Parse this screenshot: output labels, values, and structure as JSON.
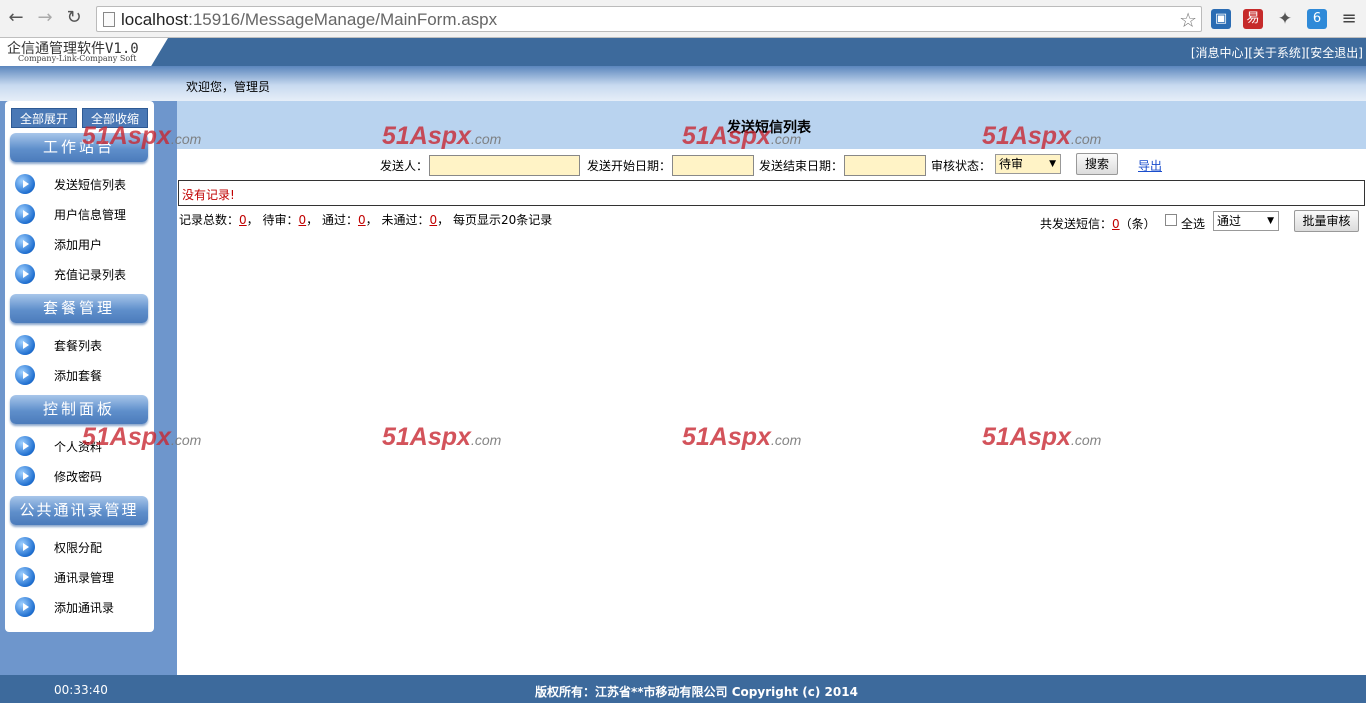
{
  "browser": {
    "url_host": "localhost",
    "url_rest": ":15916/MessageManage/MainForm.aspx"
  },
  "header": {
    "app_name": "企信通管理软件V1.0",
    "app_sub": "Company-Link-Company Soft",
    "links": [
      "[消息中心]",
      "[关于系统]",
      "[安全退出]"
    ]
  },
  "welcome": "欢迎您，管理员",
  "sidebar": {
    "expand_all": "全部展开",
    "collapse_all": "全部收缩",
    "sections": [
      {
        "title": "工作站台",
        "items": [
          "发送短信列表",
          "用户信息管理",
          "添加用户",
          "充值记录列表"
        ]
      },
      {
        "title": "套餐管理",
        "items": [
          "套餐列表",
          "添加套餐"
        ]
      },
      {
        "title": "控制面板",
        "items": [
          "个人资料",
          "修改密码"
        ]
      },
      {
        "title": "公共通讯录管理",
        "items": [
          "权限分配",
          "通讯录管理",
          "添加通讯录"
        ]
      }
    ]
  },
  "content": {
    "title": "发送短信列表",
    "search": {
      "sender_label": "发送人：",
      "start_label": "发送开始日期：",
      "end_label": "发送结束日期：",
      "status_label": "审核状态：",
      "status_value": "待审",
      "search_button": "搜索",
      "export_link": "导出"
    },
    "no_records": "没有记录!",
    "stats": {
      "total_label": "记录总数：",
      "total": "0",
      "pending_label": "待审：",
      "pending": "0",
      "passed_label": "通过：",
      "passed": "0",
      "failed_label": "未通过：",
      "failed": "0",
      "per_page": "每页显示20条记录"
    },
    "batch": {
      "sent_label": "共发送短信：",
      "sent": "0",
      "sent_unit": "（条）",
      "select_all": "全选",
      "status_value": "通过",
      "batch_button": "批量审核"
    },
    "watermark": "51Aspx",
    "watermark_suffix": ".com"
  },
  "footer": {
    "clock": "00:33:40",
    "copyright": "版权所有：江苏省**市移动有限公司 Copyright (c) 2014"
  }
}
